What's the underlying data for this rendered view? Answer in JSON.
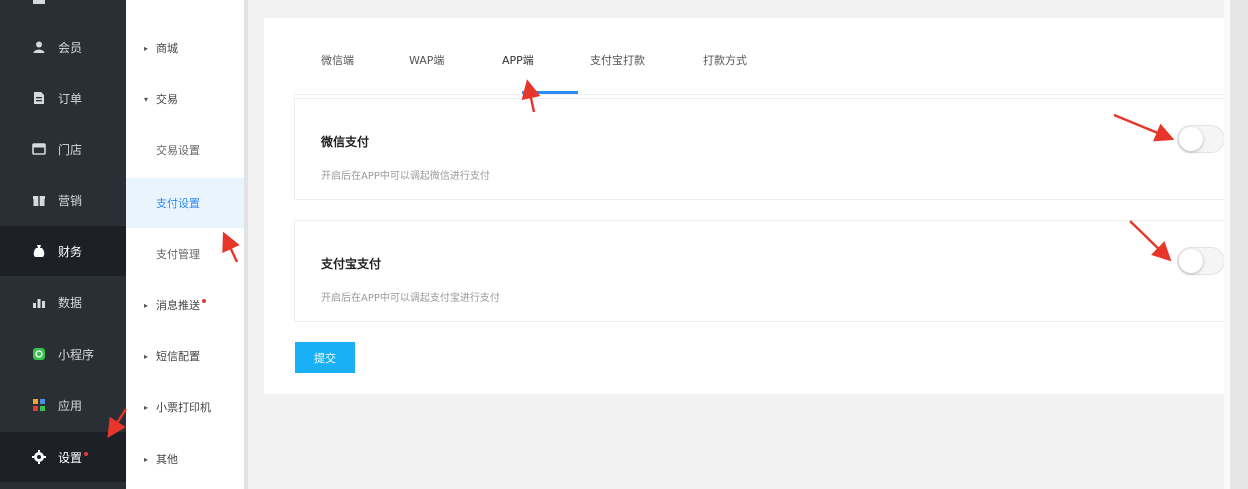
{
  "sidebar": {
    "items": [
      {
        "label": "",
        "icon": "chart-icon"
      },
      {
        "label": "会员",
        "icon": "user-icon"
      },
      {
        "label": "订单",
        "icon": "document-icon"
      },
      {
        "label": "门店",
        "icon": "store-icon"
      },
      {
        "label": "营销",
        "icon": "gift-icon"
      },
      {
        "label": "财务",
        "icon": "money-bag-icon"
      },
      {
        "label": "数据",
        "icon": "bar-chart-icon"
      },
      {
        "label": "小程序",
        "icon": "miniprogram-icon"
      },
      {
        "label": "应用",
        "icon": "apps-grid-icon"
      },
      {
        "label": "设置",
        "icon": "gear-icon"
      }
    ]
  },
  "subnav": {
    "items": [
      {
        "label": "商城",
        "arrow": "▸"
      },
      {
        "label": "交易",
        "arrow": "▾"
      },
      {
        "label": "交易设置"
      },
      {
        "label": "支付设置"
      },
      {
        "label": "支付管理"
      },
      {
        "label": "消息推送",
        "arrow": "▸"
      },
      {
        "label": "短信配置",
        "arrow": "▸"
      },
      {
        "label": "小票打印机",
        "arrow": "▸"
      },
      {
        "label": "其他",
        "arrow": "▸"
      }
    ]
  },
  "tabs": [
    "微信端",
    "WAP端",
    "APP端",
    "支付宝打款",
    "打款方式"
  ],
  "payments": [
    {
      "title": "微信支付",
      "desc": "开启后在APP中可以调起微信进行支付",
      "enabled": false
    },
    {
      "title": "支付宝支付",
      "desc": "开启后在APP中可以调起支付宝进行支付",
      "enabled": false
    }
  ],
  "submit_label": "提交",
  "colors": {
    "accent": "#2d8cf0",
    "submit": "#1ab0f5",
    "sidebar": "#2a2f36",
    "annotation": "#e8352a"
  }
}
